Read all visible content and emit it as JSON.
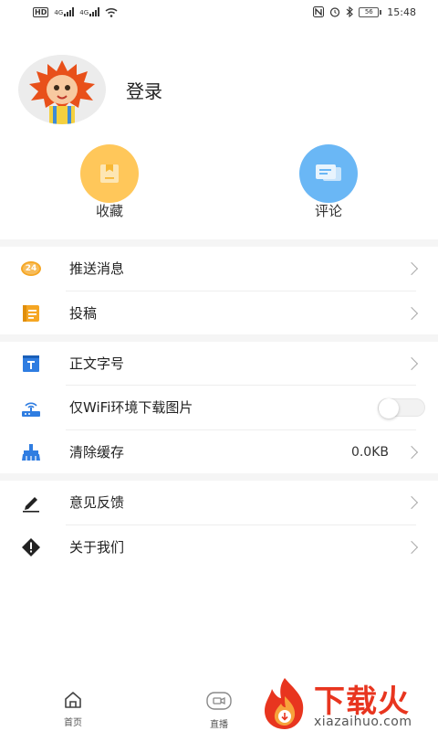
{
  "status_bar": {
    "hd": "HD",
    "sim1": "4G",
    "sim2": "4G",
    "battery": "56",
    "time": "15:48"
  },
  "profile": {
    "login_label": "登录"
  },
  "quick_actions": {
    "favorites_label": "收藏",
    "comments_label": "评论",
    "favorites_color": "#ffc75a",
    "comments_color": "#6ab7f5"
  },
  "menu": {
    "push": {
      "label": "推送消息",
      "badge": "24"
    },
    "contribute": {
      "label": "投稿"
    },
    "font_size": {
      "label": "正文字号"
    },
    "wifi_images": {
      "label": "仅WiFi环境下载图片",
      "enabled": false
    },
    "clear_cache": {
      "label": "清除缓存",
      "value": "0.0KB"
    },
    "feedback": {
      "label": "意见反馈"
    },
    "about": {
      "label": "关于我们"
    }
  },
  "tabs": {
    "home": "首页",
    "live": "直播"
  },
  "watermark": {
    "brand": "下载火",
    "url": "xiazaihuo.com"
  },
  "colors": {
    "accent_orange": "#f5a623",
    "accent_blue": "#2f7de1",
    "brand_red": "#e8351f"
  }
}
